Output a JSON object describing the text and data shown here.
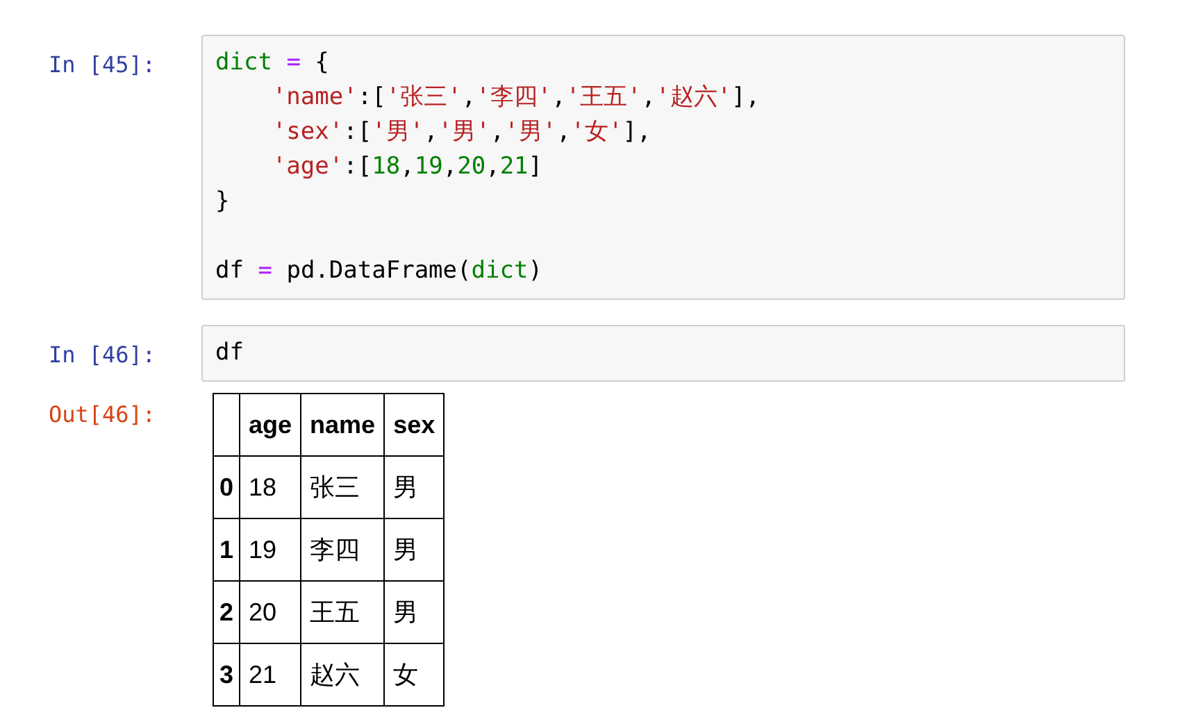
{
  "cells": [
    {
      "prompt": "In [45]:",
      "blocks": [
        [
          {
            "indent": false,
            "tokens": [
              {
                "t": "dict",
                "kind": "builtin"
              },
              {
                "t": " = ",
                "kind": "operator"
              },
              {
                "t": "{",
                "kind": "plain"
              }
            ]
          },
          {
            "indent": true,
            "tokens": [
              {
                "t": "'name'",
                "kind": "string"
              },
              {
                "t": ":[",
                "kind": "plain"
              },
              {
                "t": "'张三'",
                "kind": "string"
              },
              {
                "t": ",",
                "kind": "plain"
              },
              {
                "t": "'李四'",
                "kind": "string"
              },
              {
                "t": ",",
                "kind": "plain"
              },
              {
                "t": "'王五'",
                "kind": "string"
              },
              {
                "t": ",",
                "kind": "plain"
              },
              {
                "t": "'赵六'",
                "kind": "string"
              },
              {
                "t": "],",
                "kind": "plain"
              }
            ]
          },
          {
            "indent": true,
            "tokens": [
              {
                "t": "'sex'",
                "kind": "string"
              },
              {
                "t": ":[",
                "kind": "plain"
              },
              {
                "t": "'男'",
                "kind": "string"
              },
              {
                "t": ",",
                "kind": "plain"
              },
              {
                "t": "'男'",
                "kind": "string"
              },
              {
                "t": ",",
                "kind": "plain"
              },
              {
                "t": "'男'",
                "kind": "string"
              },
              {
                "t": ",",
                "kind": "plain"
              },
              {
                "t": "'女'",
                "kind": "string"
              },
              {
                "t": "],",
                "kind": "plain"
              }
            ]
          },
          {
            "indent": true,
            "tokens": [
              {
                "t": "'age'",
                "kind": "string"
              },
              {
                "t": ":[",
                "kind": "plain"
              },
              {
                "t": "18",
                "kind": "number"
              },
              {
                "t": ",",
                "kind": "plain"
              },
              {
                "t": "19",
                "kind": "number"
              },
              {
                "t": ",",
                "kind": "plain"
              },
              {
                "t": "20",
                "kind": "number"
              },
              {
                "t": ",",
                "kind": "plain"
              },
              {
                "t": "21",
                "kind": "number"
              },
              {
                "t": "]",
                "kind": "plain"
              }
            ]
          },
          {
            "indent": false,
            "tokens": [
              {
                "t": "}",
                "kind": "plain"
              }
            ]
          }
        ],
        [
          {
            "indent": false,
            "tokens": [
              {
                "t": "df",
                "kind": "plain"
              },
              {
                "t": " = ",
                "kind": "operator"
              },
              {
                "t": "pd.DataFrame(",
                "kind": "plain"
              },
              {
                "t": "dict",
                "kind": "builtin"
              },
              {
                "t": ")",
                "kind": "plain"
              }
            ]
          }
        ]
      ]
    },
    {
      "prompt": "In [46]:",
      "blocks": [
        [
          {
            "indent": false,
            "tokens": [
              {
                "t": "df",
                "kind": "plain"
              }
            ]
          }
        ]
      ]
    }
  ],
  "output": {
    "prompt": "Out[46]:",
    "table": {
      "columns": [
        "age",
        "name",
        "sex"
      ],
      "rows": [
        {
          "index": "0",
          "cells": [
            "18",
            "张三",
            "男"
          ]
        },
        {
          "index": "1",
          "cells": [
            "19",
            "李四",
            "男"
          ]
        },
        {
          "index": "2",
          "cells": [
            "20",
            "王五",
            "男"
          ]
        },
        {
          "index": "3",
          "cells": [
            "21",
            "赵六",
            "女"
          ]
        }
      ]
    }
  }
}
